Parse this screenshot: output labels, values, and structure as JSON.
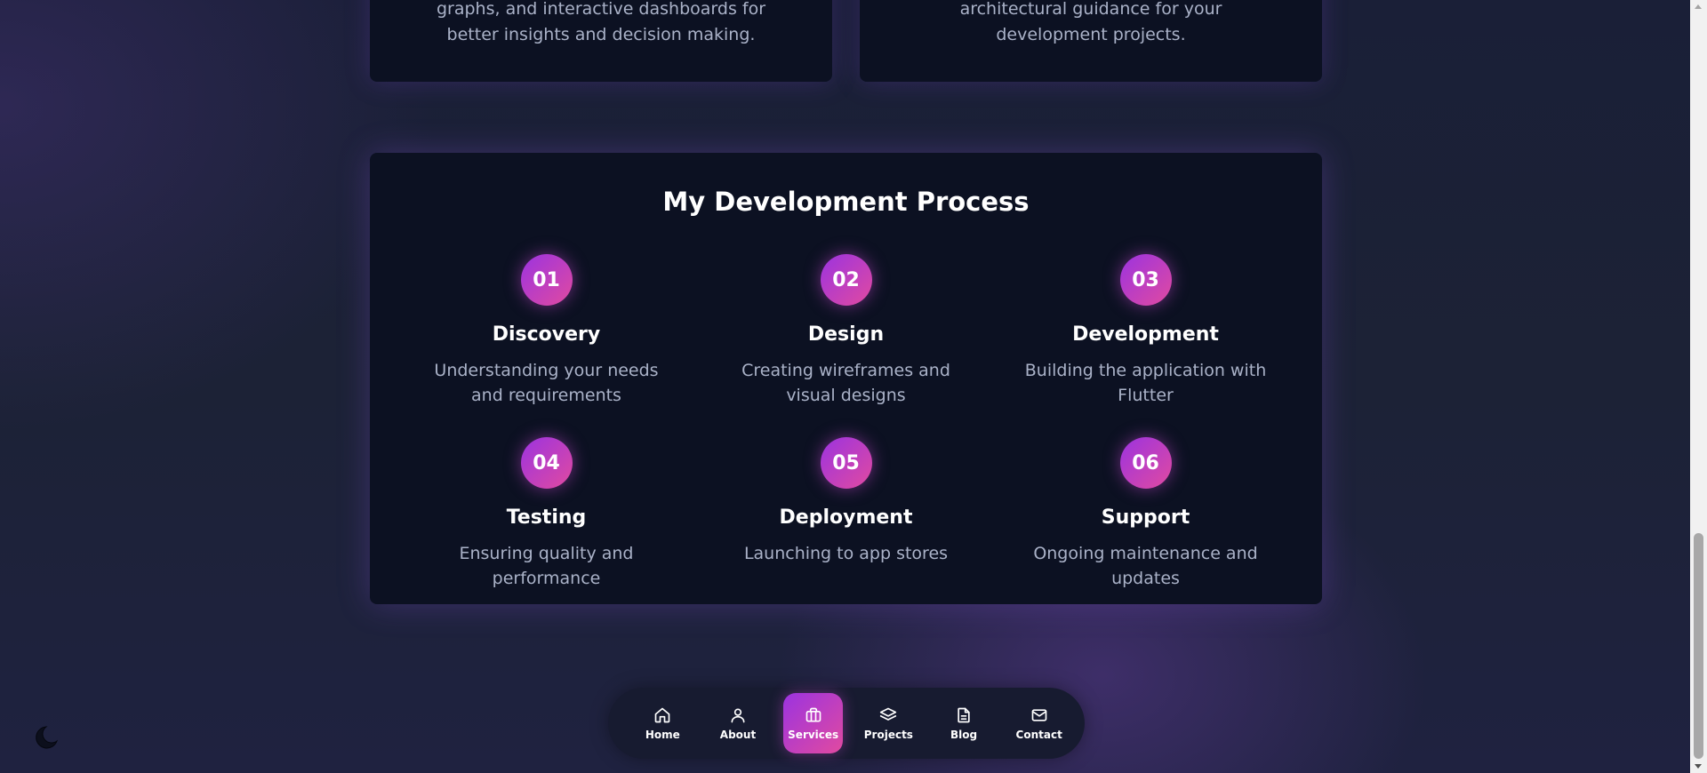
{
  "top_cards": {
    "left_text": "graphs, and interactive dashboards for better insights and decision making.",
    "right_text": "architectural guidance for your development projects."
  },
  "process": {
    "title": "My Development Process",
    "steps": [
      {
        "number": "01",
        "title": "Discovery",
        "description": "Understanding your needs and requirements"
      },
      {
        "number": "02",
        "title": "Design",
        "description": "Creating wireframes and visual designs"
      },
      {
        "number": "03",
        "title": "Development",
        "description": "Building the application with Flutter"
      },
      {
        "number": "04",
        "title": "Testing",
        "description": "Ensuring quality and performance"
      },
      {
        "number": "05",
        "title": "Deployment",
        "description": "Launching to app stores"
      },
      {
        "number": "06",
        "title": "Support",
        "description": "Ongoing maintenance and updates"
      }
    ]
  },
  "nav": {
    "items": [
      {
        "label": "Home",
        "icon": "home-icon"
      },
      {
        "label": "About",
        "icon": "user-icon"
      },
      {
        "label": "Services",
        "icon": "briefcase-icon",
        "active": true
      },
      {
        "label": "Projects",
        "icon": "layers-icon"
      },
      {
        "label": "Blog",
        "icon": "document-icon"
      },
      {
        "label": "Contact",
        "icon": "mail-icon"
      }
    ]
  },
  "theme_toggle": {
    "icon": "moon-icon"
  },
  "colors": {
    "accent_gradient_start": "#9b33e0",
    "accent_gradient_end": "#e14aa0",
    "card_background": "#0c1122",
    "muted_text": "#aab2c8"
  }
}
